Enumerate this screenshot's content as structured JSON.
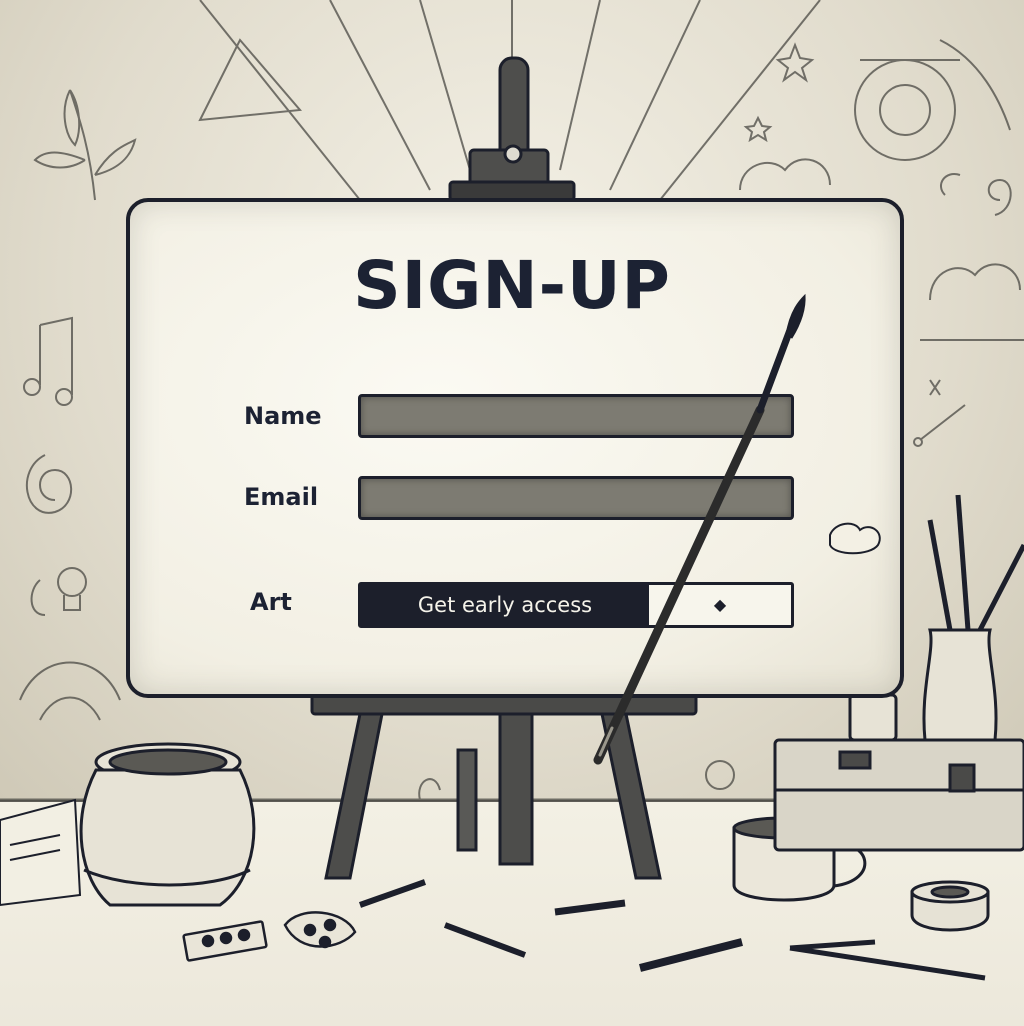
{
  "form": {
    "title": "SIGN-UP",
    "fields": {
      "name_label": "Name",
      "email_label": "Email",
      "art_label": "Art"
    },
    "art_select": {
      "selected": "Get early access"
    }
  },
  "icons": {
    "dropdown": "diamond-arrow-icon"
  },
  "colors": {
    "ink": "#1c1f2b",
    "field_fill": "#7d7b72",
    "board": "#f4f1e6",
    "wall": "#e1dccd"
  }
}
